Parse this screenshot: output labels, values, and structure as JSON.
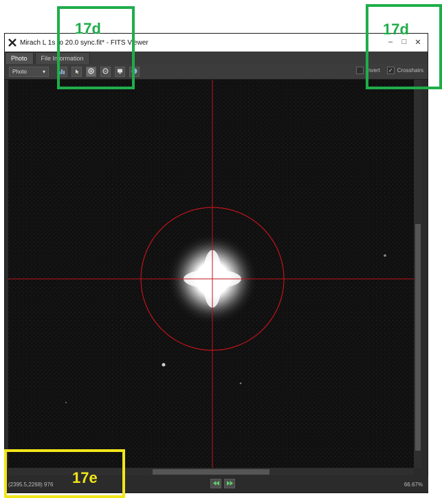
{
  "window": {
    "title": "Mirach L 1s ro 20.0 sync.fit* - FITS Viewer",
    "minimize_glyph": "–",
    "maximize_glyph": "□",
    "close_glyph": "✕"
  },
  "tabs": [
    {
      "label": "Photo",
      "active": true
    },
    {
      "label": "File Information",
      "active": false
    }
  ],
  "toolbar": {
    "mode_value": "Photo",
    "buttons": [
      "histogram-icon",
      "pointer-icon",
      "zoom-in-icon",
      "zoom-out-icon",
      "fit-screen-icon",
      "info-icon"
    ],
    "invert_label": "Invert",
    "invert_checked": false,
    "crosshairs_label": "Crosshairs",
    "crosshairs_checked": true
  },
  "status": {
    "coords": "(2395.5,2268) 976",
    "zoom": "66.67%"
  },
  "annotations": [
    {
      "label": "17d",
      "color": "#1fad4a"
    },
    {
      "label": "17d",
      "color": "#1fad4a"
    },
    {
      "label": "17e",
      "color": "#f2e51a"
    }
  ],
  "colors": {
    "crosshair": "#c0141c",
    "green_callout": "#1fad4a",
    "yellow_callout": "#f2e51a"
  }
}
